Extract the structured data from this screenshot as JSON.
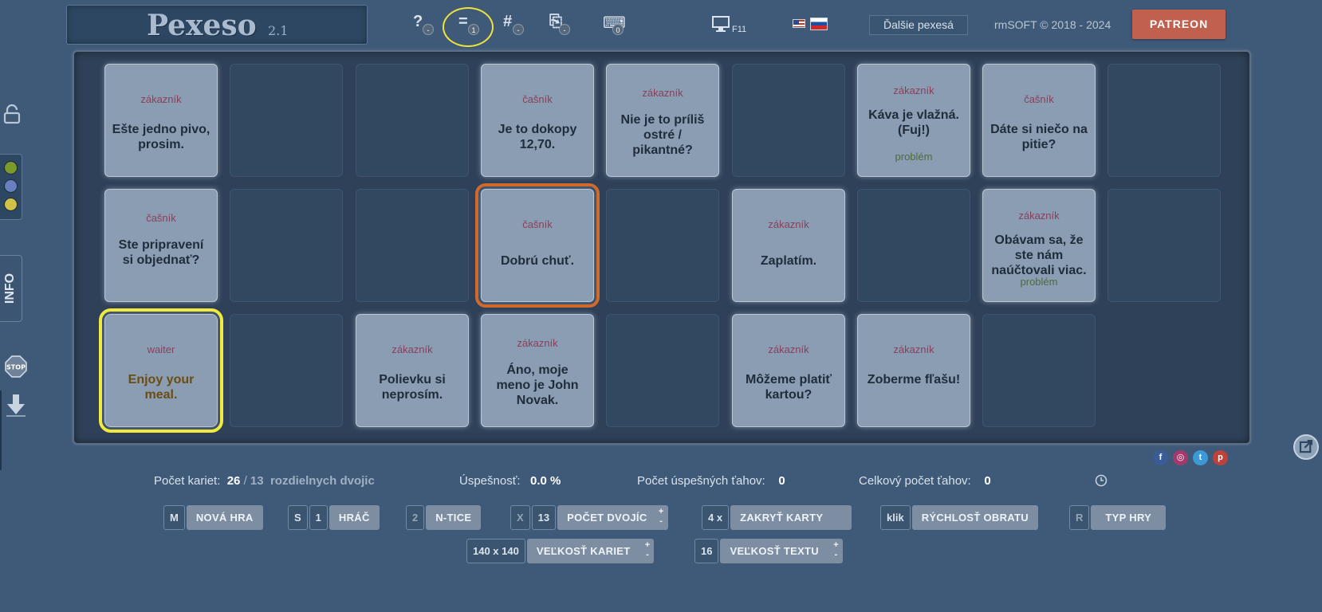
{
  "app": {
    "title": "Pexeso",
    "version": "2.1"
  },
  "toolbar": {
    "icons": [
      {
        "name": "help-icon",
        "glyph": "?",
        "badge": "-"
      },
      {
        "name": "pairs-icon",
        "glyph": "=",
        "badge": "1"
      },
      {
        "name": "hash-icon",
        "glyph": "#",
        "badge": "-"
      },
      {
        "name": "cards-icon",
        "glyph": "⎘",
        "badge": "-"
      },
      {
        "name": "keyboard-icon",
        "glyph": "⌨",
        "badge": "0"
      }
    ],
    "fullscreen_key": "F11",
    "other_games": "Ďalšie pexesá",
    "copyright": "rmSOFT © 2018 - 2024",
    "patreon": "PATREON"
  },
  "sidebar": {
    "info_label": "INFO",
    "stop_label": "STOP",
    "colors": [
      "#7c9a2a",
      "#6a7fbf",
      "#d0c248"
    ]
  },
  "board": {
    "rows": 3,
    "cols": 9,
    "cards": [
      {
        "row": 0,
        "col": 0,
        "role": "zákazník",
        "text": "Ešte jedno pivo, prosim.",
        "tag": ""
      },
      {
        "row": 0,
        "col": 3,
        "role": "čašník",
        "text": "Je to dokopy 12,70.",
        "tag": ""
      },
      {
        "row": 0,
        "col": 4,
        "role": "zákazník",
        "text": "Nie je to príliš ostré / pikantné?",
        "tag": ""
      },
      {
        "row": 0,
        "col": 6,
        "role": "zákazník",
        "text": "Káva je vlažná. (Fuj!)",
        "tag": "problém"
      },
      {
        "row": 0,
        "col": 7,
        "role": "čašník",
        "text": "Dáte si niečo na pitie?",
        "tag": ""
      },
      {
        "row": 1,
        "col": 0,
        "role": "čašník",
        "text": "Ste pripravení si objednať?",
        "tag": ""
      },
      {
        "row": 1,
        "col": 3,
        "role": "čašník",
        "text": "Dobrú chuť.",
        "tag": "",
        "selected": "orange"
      },
      {
        "row": 1,
        "col": 5,
        "role": "zákazník",
        "text": "Zaplatím.",
        "tag": ""
      },
      {
        "row": 1,
        "col": 7,
        "role": "zákazník",
        "text": "Obávam sa, že ste nám naúčtovali viac.",
        "tag": "problém"
      },
      {
        "row": 2,
        "col": 0,
        "role": "waiter",
        "text": "Enjoy your meal.",
        "tag": "",
        "selected": "yellow"
      },
      {
        "row": 2,
        "col": 2,
        "role": "zákazník",
        "text": "Polievku si neprosím.",
        "tag": ""
      },
      {
        "row": 2,
        "col": 3,
        "role": "zákazník",
        "text": "Áno, moje meno je John Novak.",
        "tag": ""
      },
      {
        "row": 2,
        "col": 5,
        "role": "zákazník",
        "text": "Môžeme platiť kartou?",
        "tag": ""
      },
      {
        "row": 2,
        "col": 6,
        "role": "zákazník",
        "text": "Zoberme fľašu!",
        "tag": ""
      }
    ],
    "empty_slots_last_row_until_col": 7
  },
  "stats": {
    "cards_label": "Počet kariet:",
    "cards_value": "26",
    "slash": "/",
    "pairs_value": "13",
    "pairs_label": "rozdielnych dvojic",
    "success_label": "Úspešnosť:",
    "success_value": "0.0 %",
    "good_moves_label": "Počet úspešných ťahov:",
    "good_moves_value": "0",
    "total_moves_label": "Celkový počet ťahov:",
    "total_moves_value": "0"
  },
  "social": [
    {
      "name": "facebook-icon",
      "glyph": "f",
      "color": "#3b5b98"
    },
    {
      "name": "instagram-icon",
      "glyph": "◎",
      "color": "#a33a6b"
    },
    {
      "name": "twitter-icon",
      "glyph": "t",
      "color": "#3b9ad6"
    },
    {
      "name": "pinterest-icon",
      "glyph": "p",
      "color": "#c0403a"
    }
  ],
  "controls": {
    "new_game": {
      "key": "M",
      "label": "NOVÁ HRA"
    },
    "player": {
      "key": "S",
      "value": "1",
      "label": "HRÁČ"
    },
    "ntice": {
      "value": "2",
      "label": "N-TICE"
    },
    "pairs": {
      "key": "X",
      "value": "13",
      "label": "POČET DVOJÍC"
    },
    "cover": {
      "value": "4 x",
      "label": "ZAKRYŤ KARTY"
    },
    "speed": {
      "value": "klik",
      "label": "RÝCHLOSŤ OBRATU"
    },
    "type": {
      "key": "R",
      "label": "TYP HRY"
    },
    "card_size": {
      "value": "140 x 140",
      "label": "VEĽKOSŤ KARIET"
    },
    "text_size": {
      "value": "16",
      "label": "VEĽKOSŤ TEXTU"
    },
    "plus": "+",
    "minus": "-"
  }
}
